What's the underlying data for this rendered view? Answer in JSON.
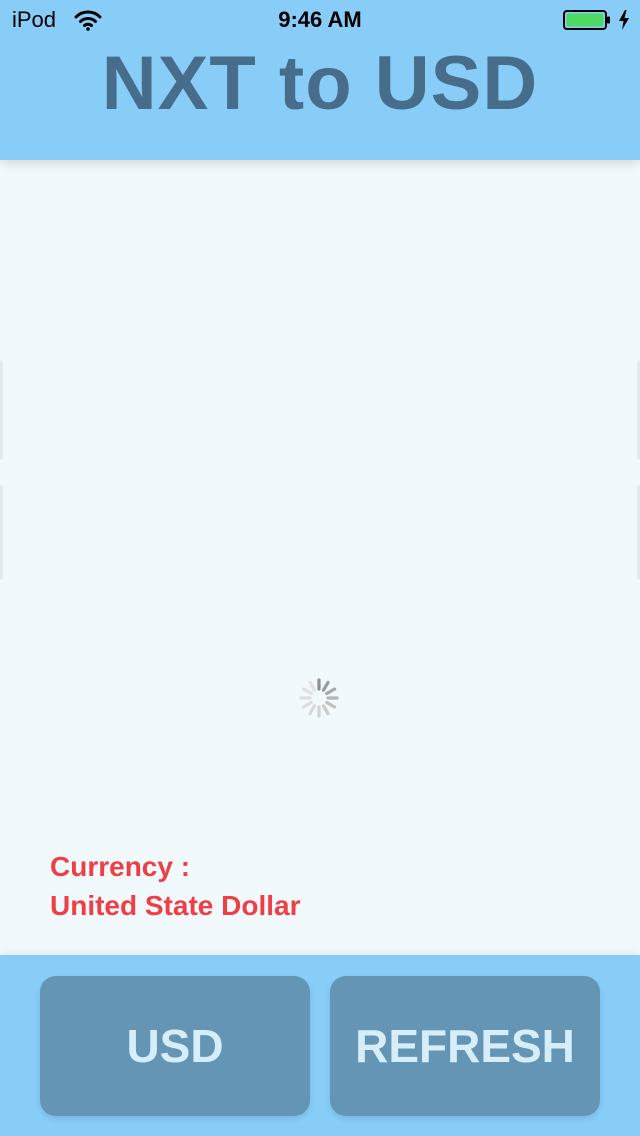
{
  "status_bar": {
    "carrier": "iPod",
    "time": "9:46 AM",
    "wifi_icon": "wifi-icon",
    "battery_icon": "battery-icon",
    "charge_icon": "charging-bolt-icon",
    "battery_level": 1.0
  },
  "header": {
    "title": "NXT to USD"
  },
  "main": {
    "loading": true,
    "spinner_icon": "activity-spinner-icon",
    "currency_label": "Currency :",
    "currency_name": "United State Dollar"
  },
  "footer": {
    "usd_label": "USD",
    "refresh_label": "REFRESH"
  },
  "colors": {
    "header_bg": "#87cdf8",
    "title_text": "#476d8a",
    "content_bg": "#f1f9fc",
    "currency_text": "#ee3f45",
    "button_bg": "#6595b5",
    "button_text": "#d5eefa",
    "battery_fill": "#4cd964"
  }
}
